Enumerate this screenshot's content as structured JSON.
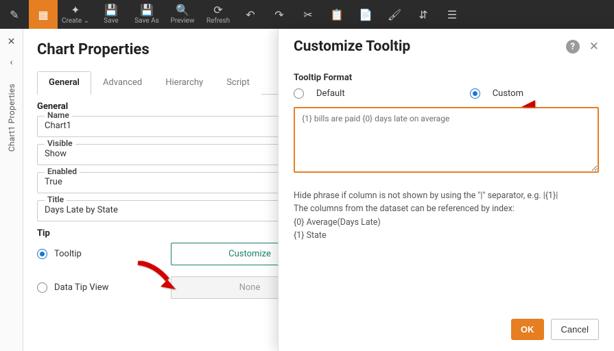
{
  "toolbar": {
    "items": [
      {
        "label": "",
        "glyph": "✎"
      },
      {
        "label": "",
        "glyph": "▦"
      },
      {
        "label": "Create ⌄",
        "glyph": "✦"
      },
      {
        "label": "Save",
        "glyph": "💾"
      },
      {
        "label": "Save As",
        "glyph": "💾"
      },
      {
        "label": "Preview",
        "glyph": "🔍"
      },
      {
        "label": "Refresh",
        "glyph": "⟳"
      },
      {
        "label": "",
        "glyph": "↶"
      },
      {
        "label": "",
        "glyph": "↷"
      },
      {
        "label": "",
        "glyph": "✂"
      },
      {
        "label": "",
        "glyph": "📋"
      },
      {
        "label": "",
        "glyph": "📄"
      },
      {
        "label": "",
        "glyph": "🖌"
      },
      {
        "label": "",
        "glyph": "⇵"
      },
      {
        "label": "",
        "glyph": "☰"
      }
    ]
  },
  "rail": {
    "title": "Chart1  Properties"
  },
  "properties": {
    "title": "Chart Properties",
    "tabs": [
      "General",
      "Advanced",
      "Hierarchy",
      "Script"
    ],
    "active_tab": 0,
    "general_label": "General",
    "fields": {
      "name": {
        "legend": "Name",
        "value": "Chart1"
      },
      "visible": {
        "legend": "Visible",
        "value": "Show"
      },
      "enabled": {
        "legend": "Enabled",
        "value": "True"
      },
      "title": {
        "legend": "Title",
        "value": "Days Late by State"
      }
    },
    "tip": {
      "heading": "Tip",
      "opt_tooltip": "Tooltip",
      "opt_datatip": "Data Tip View",
      "customize_btn": "Customize",
      "none_btn": "None"
    }
  },
  "modal": {
    "title": "Customize Tooltip",
    "format_label": "Tooltip Format",
    "opt_default": "Default",
    "opt_custom": "Custom",
    "textarea_value": "{1} bills are paid {0} days late on average",
    "hint_line1": "Hide phrase if column is not shown by using the \"|\" separator, e.g. |{1}|",
    "hint_line2": "The columns from the dataset can be referenced by index:",
    "hint_line3": "{0} Average(Days Late)",
    "hint_line4": "{1} State",
    "ok": "OK",
    "cancel": "Cancel"
  }
}
